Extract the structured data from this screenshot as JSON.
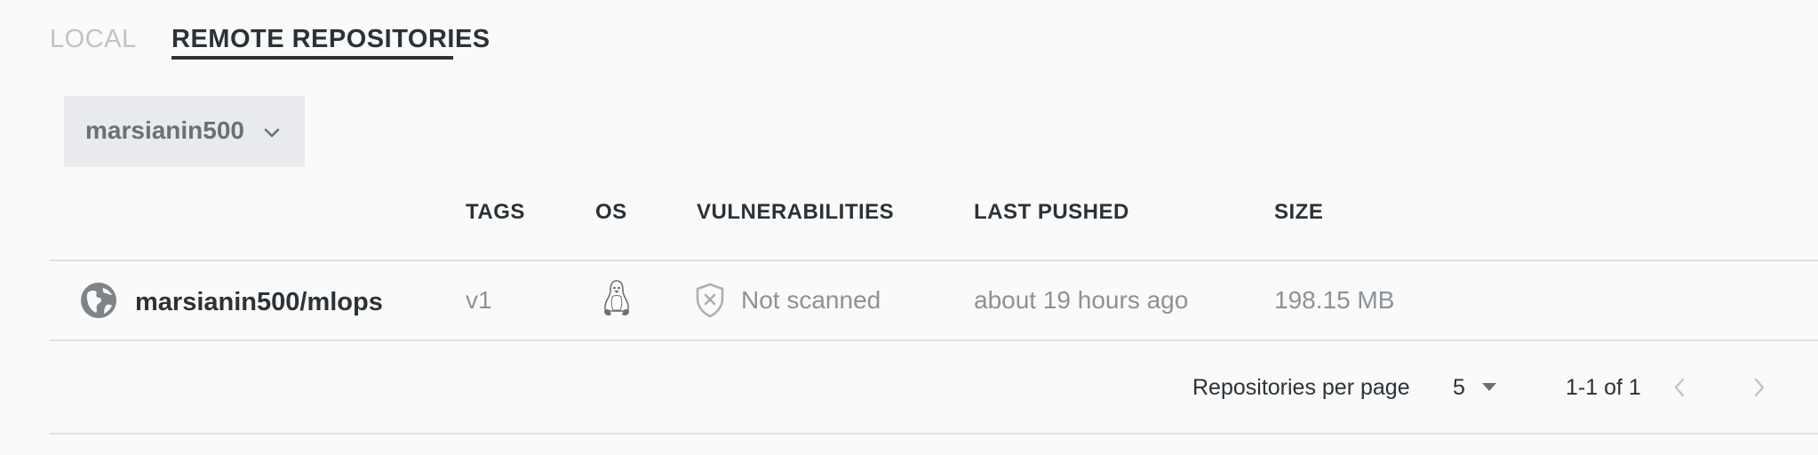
{
  "tabs": [
    {
      "label": "LOCAL",
      "active": false
    },
    {
      "label": "REMOTE REPOSITORIES",
      "active": true
    }
  ],
  "org_selector": {
    "value": "marsianin500",
    "icon": "chevron-down-icon"
  },
  "table": {
    "columns": [
      "TAGS",
      "OS",
      "VULNERABILITIES",
      "LAST PUSHED",
      "SIZE"
    ],
    "rows": [
      {
        "icon": "globe-icon",
        "name": "marsianin500/mlops",
        "tags": "v1",
        "os_icon": "linux-icon",
        "vulnerabilities": "Not scanned",
        "last_pushed": "about 19 hours ago",
        "size": "198.15 MB"
      }
    ]
  },
  "pagination": {
    "per_page_label": "Repositories per page",
    "per_page_value": "5",
    "range": "1-1 of 1"
  },
  "colors": {
    "text_dark": "#2b3237",
    "text_muted": "#8c9297",
    "tab_inactive": "#bfc3c7",
    "dropdown_bg": "#e9eaed",
    "background": "#fafafa",
    "divider": "#dfe1e3"
  }
}
